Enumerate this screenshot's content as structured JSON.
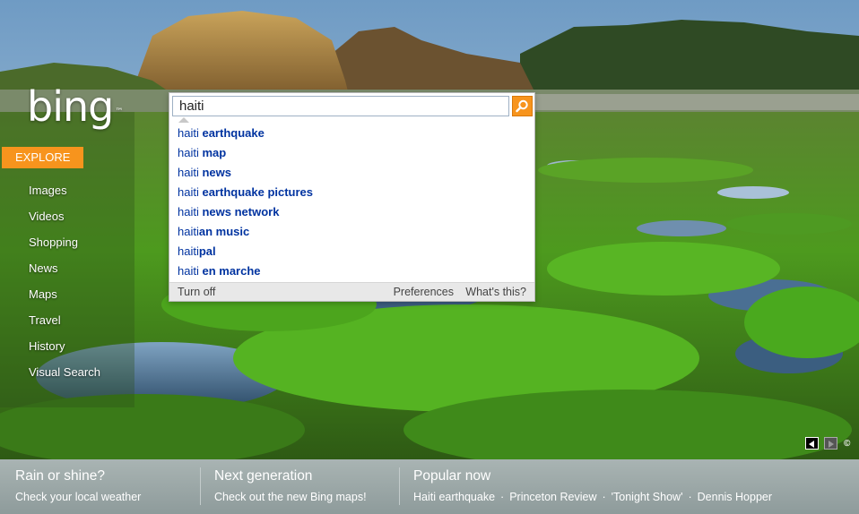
{
  "logo": {
    "text": "bing",
    "tm": "™"
  },
  "explore": {
    "label": "EXPLORE"
  },
  "nav": {
    "items": [
      "Images",
      "Videos",
      "Shopping",
      "News",
      "Maps",
      "Travel",
      "History",
      "Visual Search"
    ]
  },
  "search": {
    "value": "haiti",
    "button_icon": "search-icon"
  },
  "suggestions": [
    {
      "prefix": "haiti",
      "rest": " earthquake"
    },
    {
      "prefix": "haiti",
      "rest": " map"
    },
    {
      "prefix": "haiti",
      "rest": " news"
    },
    {
      "prefix": "haiti",
      "rest": " earthquake pictures"
    },
    {
      "prefix": "haiti",
      "rest": " news network"
    },
    {
      "prefix": "haiti",
      "rest": "an music"
    },
    {
      "prefix": "haiti",
      "rest": "pal"
    },
    {
      "prefix": "haiti",
      "rest": " en marche"
    }
  ],
  "suggest_footer": {
    "turn_off": "Turn off",
    "preferences": "Preferences",
    "whats_this": "What's this?"
  },
  "image_nav": {
    "prev_icon": "prev-arrow-icon",
    "next_icon": "next-arrow-icon",
    "copyright": "©"
  },
  "bottom": {
    "weather": {
      "title": "Rain or shine?",
      "link": "Check your local weather"
    },
    "maps": {
      "title": "Next generation",
      "link": "Check out the new Bing maps!"
    },
    "popular": {
      "title": "Popular now",
      "items": [
        "Haiti earthquake",
        "Princeton Review",
        "'Tonight Show'",
        "Dennis Hopper"
      ],
      "separator": "·"
    }
  },
  "colors": {
    "accent_orange": "#f7941d",
    "link_blue": "#0033a0",
    "bottom_bar": "#98a4a4"
  }
}
